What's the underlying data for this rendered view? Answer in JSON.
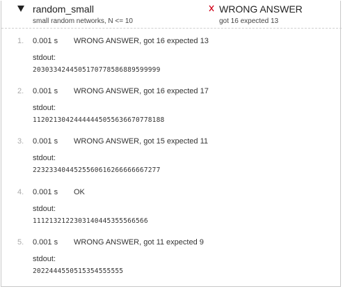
{
  "group": {
    "name": "random_small",
    "description": "small random networks, N <= 10",
    "verdict_icon": "x-mark-icon",
    "verdict_title": "WRONG ANSWER",
    "verdict_detail": "got 16 expected 13",
    "colors": {
      "verdict_icon": "#d0021b"
    }
  },
  "cases": [
    {
      "num": "1.",
      "time": "0.001 s",
      "verdict": "WRONG ANSWER",
      "detail": ", got 16 expected 13",
      "stdout_label": "stdout:",
      "stdout": "2030334244505170778586889599999"
    },
    {
      "num": "2.",
      "time": "0.001 s",
      "verdict": "WRONG ANSWER",
      "detail": ", got 16 expected 17",
      "stdout_label": "stdout:",
      "stdout": "11202130424444445055636670778188"
    },
    {
      "num": "3.",
      "time": "0.001 s",
      "verdict": "WRONG ANSWER",
      "detail": ", got 15 expected 11",
      "stdout_label": "stdout:",
      "stdout": "2232334044525560616266666667277"
    },
    {
      "num": "4.",
      "time": "0.001 s",
      "verdict": "OK",
      "detail": "",
      "stdout_label": "stdout:",
      "stdout": "1112132122303140445355566566"
    },
    {
      "num": "5.",
      "time": "0.001 s",
      "verdict": "WRONG ANSWER",
      "detail": ", got 11 expected 9",
      "stdout_label": "stdout:",
      "stdout": "2022444550515354555555"
    }
  ]
}
